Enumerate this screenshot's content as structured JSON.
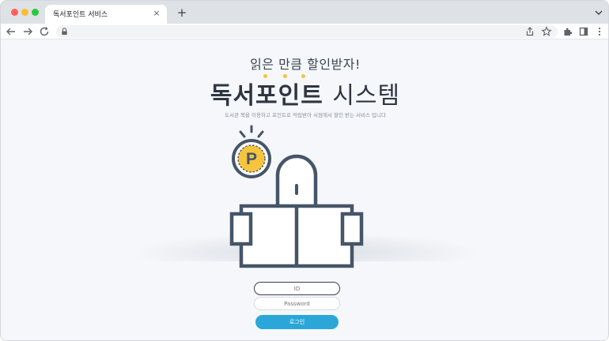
{
  "browser": {
    "tab_title": "독서포인트 서비스",
    "tab_close": "×",
    "new_tab": "+"
  },
  "hero": {
    "subtitle": "읽은 만큼 할인받자!",
    "title_bold": "독서포인트",
    "title_light": "시스템",
    "description": "도서관 책을 이용하고 포인트로 적립받아 서점에서 할인 받는 서비스 입니다",
    "badge_letter": "P"
  },
  "login": {
    "id_placeholder": "ID",
    "password_placeholder": "Password",
    "button_label": "로그인"
  },
  "colors": {
    "accent_blue": "#2aa7d8",
    "accent_yellow": "#f7c43d",
    "illustration_stroke": "#465568"
  },
  "icons": [
    "back-arrow-icon",
    "forward-arrow-icon",
    "reload-icon",
    "lock-icon",
    "share-icon",
    "star-icon",
    "extensions-icon",
    "sidebar-icon",
    "more-icon",
    "chevron-down-icon",
    "coin-p-icon",
    "reader-book-icon"
  ]
}
